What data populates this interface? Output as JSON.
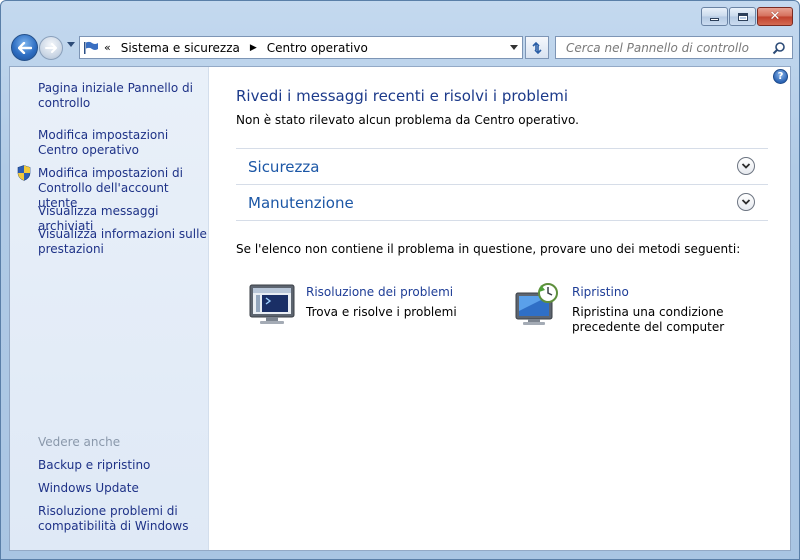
{
  "window": {
    "close_glyph": "✕"
  },
  "navbar": {
    "breadcrumb_overflow": "«",
    "breadcrumbs": [
      "Sistema e sicurezza",
      "Centro operativo"
    ],
    "crumb_separator": "▶",
    "search_placeholder": "Cerca nel Pannello di controllo"
  },
  "sidebar": {
    "links": [
      "Pagina iniziale Pannello di controllo",
      "Modifica impostazioni Centro operativo",
      "Modifica impostazioni di Controllo dell'account utente",
      "Visualizza messaggi archiviati",
      "Visualizza informazioni sulle prestazioni"
    ],
    "see_also_heading": "Vedere anche",
    "see_also_links": [
      "Backup e ripristino",
      "Windows Update",
      "Risoluzione problemi di compatibilità di Windows"
    ]
  },
  "main": {
    "help_glyph": "?",
    "title": "Rivedi i messaggi recenti e risolvi i problemi",
    "subtitle": "Non è stato rilevato alcun problema da Centro operativo.",
    "sections": [
      "Sicurezza",
      "Manutenzione"
    ],
    "hint": "Se l'elenco non contiene il problema in questione, provare uno dei metodi seguenti:",
    "tasks": [
      {
        "icon": "troubleshooting-icon",
        "link": "Risoluzione dei problemi",
        "desc": "Trova e risolve i problemi"
      },
      {
        "icon": "system-restore-icon",
        "link": "Ripristino",
        "desc": "Ripristina una condizione precedente del computer"
      }
    ]
  },
  "colors": {
    "link": "#1e3287",
    "title": "#1c3a8a",
    "section": "#1c57a6",
    "sidebar_bg": "#e9f0f9",
    "frame": "#b1cbe6"
  }
}
